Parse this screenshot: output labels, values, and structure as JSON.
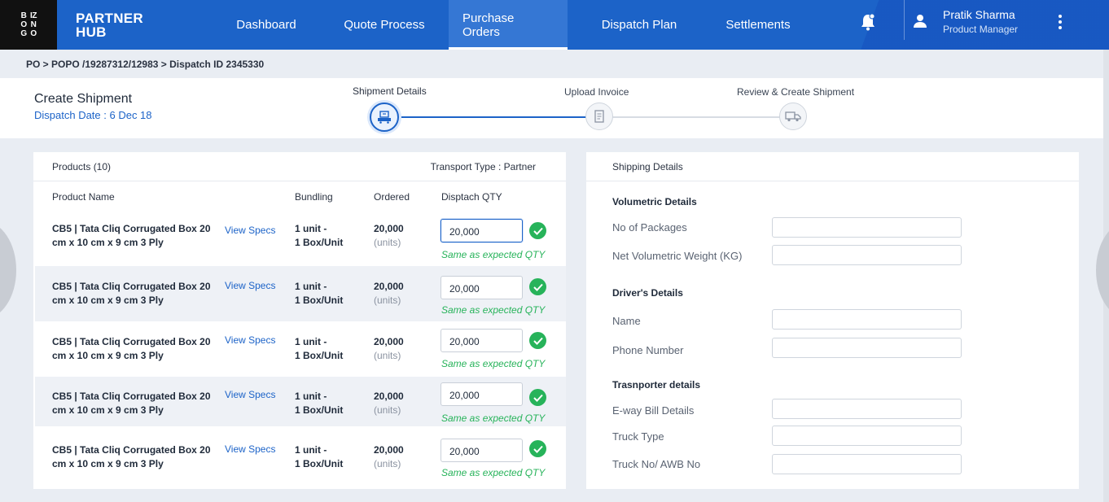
{
  "brand": {
    "logo_letters": [
      "B",
      "IZ",
      "O",
      "N",
      "G",
      "O"
    ],
    "title_line1": "PARTNER",
    "title_line2": "HUB"
  },
  "nav": {
    "items": [
      {
        "label": "Dashboard",
        "active": false
      },
      {
        "label": "Quote Process",
        "active": false
      },
      {
        "label": "Purchase Orders",
        "active": true
      },
      {
        "label": "Dispatch Plan",
        "active": false
      },
      {
        "label": "Settlements",
        "active": false
      }
    ],
    "icons": [
      "bell-icon",
      "user-icon",
      "kebab-menu-icon"
    ],
    "user": {
      "name": "Pratik Sharma",
      "role": "Product Manager"
    },
    "colors": {
      "nav_bg": "#1c63c8",
      "active_tab_bg": "#3577d4"
    }
  },
  "breadcrumb": "PO > POPO /19287312/12983 > Dispatch ID 2345330",
  "shipment": {
    "title": "Create Shipment",
    "dispatch_date": "Dispatch Date : 6 Dec 18",
    "steps": [
      {
        "label": "Shipment Details",
        "icon": "shipment-details-icon",
        "active": true
      },
      {
        "label": "Upload Invoice",
        "icon": "invoice-icon",
        "active": false
      },
      {
        "label": "Review & Create Shipment",
        "icon": "truck-icon",
        "active": false
      }
    ]
  },
  "products": {
    "title": "Products (10)",
    "transport_type": "Transport Type : Partner",
    "columns": [
      "Product Name",
      "Bundling",
      "Ordered",
      "Disptach QTY"
    ],
    "rows": [
      {
        "name_line1": "CB5 | Tata Cliq Corrugated Box 20",
        "name_line2": "cm x 10 cm x 9 cm 3 Ply",
        "specs": "View Specs",
        "bundling_line1": "1 unit -",
        "bundling_line2": "1 Box/Unit",
        "ordered": "20,000",
        "ordered_unit": "(units)",
        "dispatch_qty": "20,000",
        "note": "Same as expected QTY"
      },
      {
        "name_line1": "CB5 | Tata Cliq Corrugated Box 20",
        "name_line2": "cm x 10 cm x 9 cm 3 Ply",
        "specs": "View Specs",
        "bundling_line1": "1 unit -",
        "bundling_line2": "1 Box/Unit",
        "ordered": "20,000",
        "ordered_unit": "(units)",
        "dispatch_qty": "20,000",
        "note": "Same as expected QTY"
      },
      {
        "name_line1": "CB5 | Tata Cliq Corrugated Box 20",
        "name_line2": "cm x 10 cm x 9 cm 3 Ply",
        "specs": "View Specs",
        "bundling_line1": "1 unit -",
        "bundling_line2": "1 Box/Unit",
        "ordered": "20,000",
        "ordered_unit": "(units)",
        "dispatch_qty": "20,000",
        "note": "Same as expected QTY"
      },
      {
        "name_line1": "CB5 | Tata Cliq Corrugated Box 20",
        "name_line2": "cm x 10 cm x 9 cm 3 Ply",
        "specs": "View Specs",
        "bundling_line1": "1 unit -",
        "bundling_line2": "1 Box/Unit",
        "ordered": "20,000",
        "ordered_unit": "(units)",
        "dispatch_qty": "20,000",
        "note": "Same as expected QTY"
      },
      {
        "name_line1": "CB5 | Tata Cliq Corrugated Box 20",
        "name_line2": "cm x 10 cm x 9 cm 3 Ply",
        "specs": "View Specs",
        "bundling_line1": "1 unit -",
        "bundling_line2": "1 Box/Unit",
        "ordered": "20,000",
        "ordered_unit": "(units)",
        "dispatch_qty": "20,000",
        "note": "Same as expected QTY"
      }
    ],
    "status_color": "#27b35a"
  },
  "shipping": {
    "title": "Shipping Details",
    "sections": [
      {
        "heading": "Volumetric Details",
        "fields": [
          {
            "label": "No of Packages",
            "value": ""
          },
          {
            "label": "Net Volumetric Weight (KG)",
            "value": ""
          }
        ]
      },
      {
        "heading": "Driver's Details",
        "fields": [
          {
            "label": "Name",
            "value": ""
          },
          {
            "label": "Phone Number",
            "value": ""
          }
        ]
      },
      {
        "heading": "Trasnporter details",
        "fields": [
          {
            "label": "E-way Bill Details",
            "value": ""
          },
          {
            "label": "Truck Type",
            "value": ""
          },
          {
            "label": "Truck No/ AWB No",
            "value": ""
          }
        ]
      }
    ]
  }
}
